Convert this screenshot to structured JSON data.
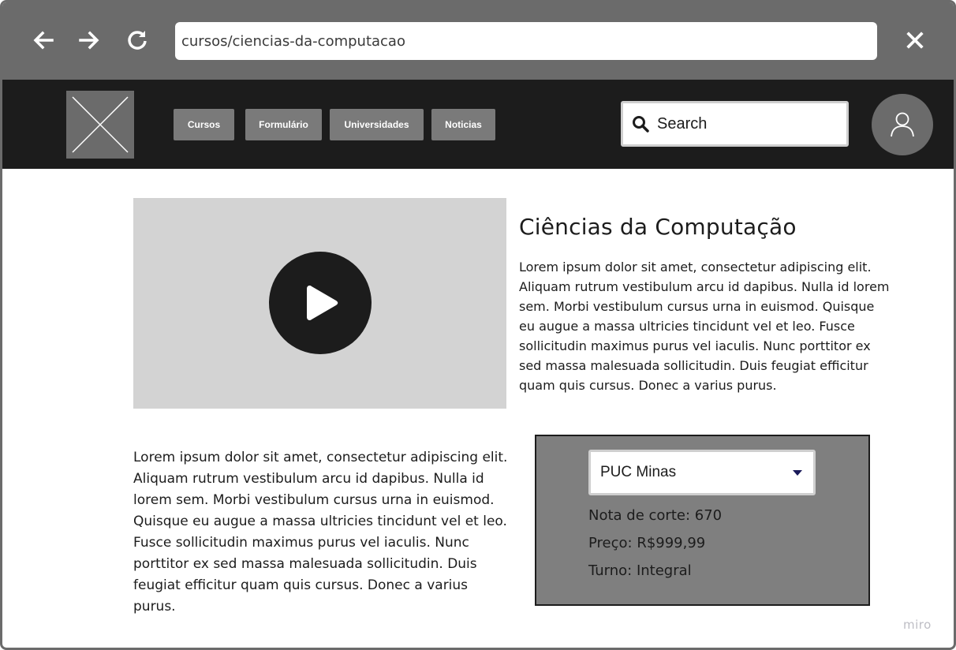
{
  "browser": {
    "url": "cursos/ciencias-da-computacao",
    "back_icon": "arrow-left-icon",
    "forward_icon": "arrow-right-icon",
    "reload_icon": "reload-icon",
    "close_icon": "close-icon"
  },
  "header": {
    "logo_icon": "image-placeholder-icon",
    "menu": [
      "Cursos",
      "Formulário",
      "Universidades",
      "Noticias"
    ],
    "search_placeholder": "Search",
    "avatar_icon": "user-icon"
  },
  "main": {
    "video_icon": "play-icon",
    "title": "Ciências da Computação",
    "description": "Lorem ipsum dolor sit amet, consectetur adipiscing elit. Aliquam rutrum vestibulum arcu id dapibus. Nulla id lorem sem. Morbi vestibulum cursus urna in euismod. Quisque eu augue a massa ultricies tincidunt vel et leo. Fusce sollicitudin maximus purus vel iaculis. Nunc porttitor ex sed massa malesuada sollicitudin. Duis feugiat efficitur quam quis cursus. Donec a varius purus.",
    "body_text": "Lorem ipsum dolor sit amet, consectetur adipiscing elit. Aliquam rutrum vestibulum arcu id dapibus. Nulla id lorem sem. Morbi vestibulum cursus urna in euismod. Quisque eu augue a massa ultricies tincidunt vel et leo. Fusce sollicitudin maximus purus vel iaculis. Nunc porttitor ex sed massa malesuada sollicitudin. Duis feugiat efficitur quam quis cursus. Donec a varius purus."
  },
  "info_panel": {
    "selected_university": "PUC Minas",
    "nota_corte": "Nota de corte: 670",
    "preco": "Preço: R$999,99",
    "turno": "Turno: Integral"
  },
  "watermark": "miro",
  "colors": {
    "browser_chrome": "#6b6b6b",
    "header_bg": "#1c1c1c",
    "button_bg": "#7a7a7a",
    "video_bg": "#d3d3d3",
    "panel_bg": "#7f7f7f"
  }
}
